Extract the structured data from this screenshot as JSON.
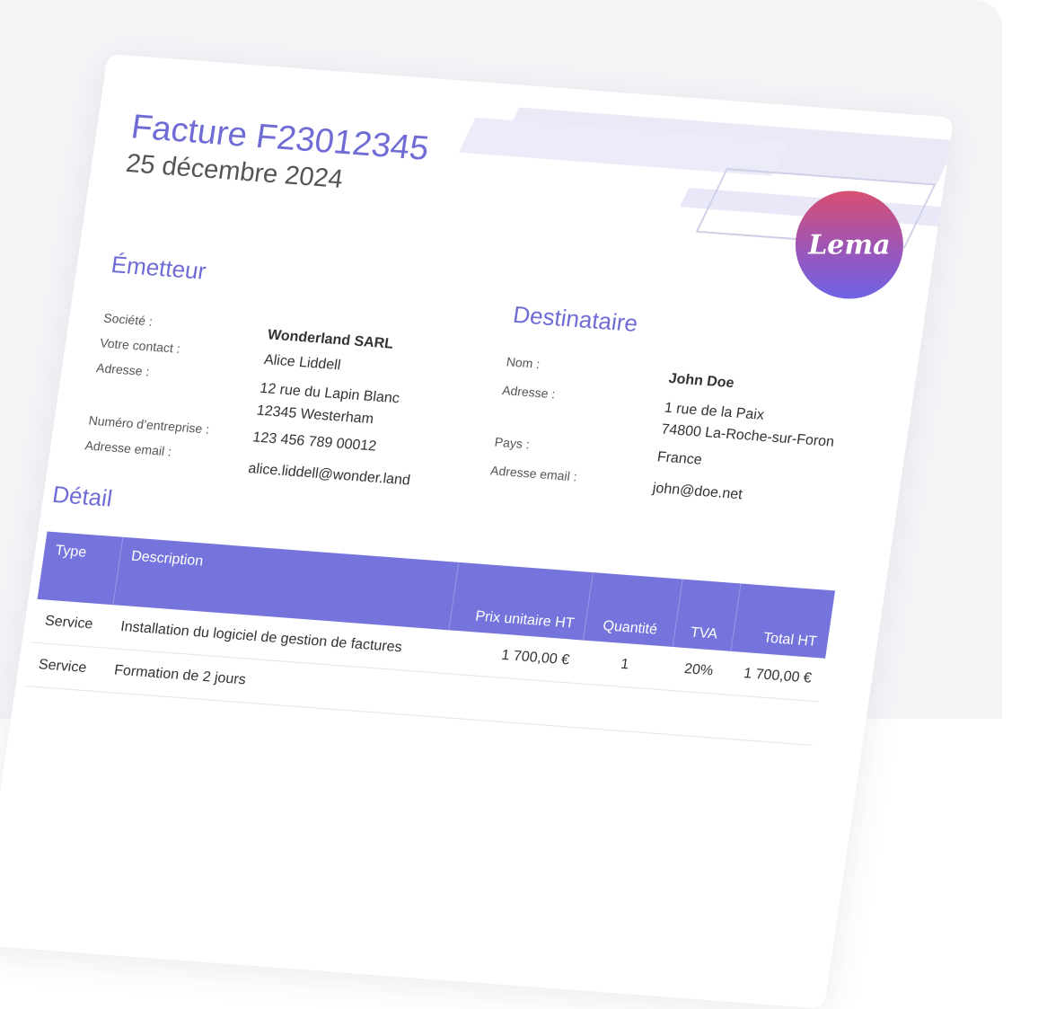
{
  "invoice": {
    "title": "Facture F23012345",
    "date": "25 décembre 2024",
    "logo_text": "Lema"
  },
  "emitter": {
    "heading": "Émetteur",
    "company_label": "Société :",
    "contact_label": "Votre contact :",
    "address_label": "Adresse :",
    "company_number_label": "Numéro d’entreprise :",
    "email_label": "Adresse email :",
    "company": "Wonderland SARL",
    "contact": "Alice Liddell",
    "address_line1": "12 rue du Lapin Blanc",
    "address_line2": "12345 Westerham",
    "company_number": "123 456 789 00012",
    "email": "alice.liddell@wonder.land"
  },
  "recipient": {
    "heading": "Destinataire",
    "name_label": "Nom :",
    "address_label": "Adresse :",
    "country_label": "Pays :",
    "email_label": "Adresse email :",
    "name": "John Doe",
    "address_line1": "1 rue de la Paix",
    "address_line2": "74800 La-Roche-sur-Foron",
    "country": "France",
    "email": "john@doe.net"
  },
  "detail": {
    "heading": "Détail",
    "columns": [
      "Type",
      "Description",
      "Prix unitaire HT",
      "Quantité",
      "TVA",
      "Total HT"
    ],
    "rows": [
      {
        "type": "Service",
        "description": "Installation du logiciel de gestion de factures",
        "unit_price": "1 700,00 €",
        "quantity": "1",
        "vat": "20%",
        "total": "1 700,00 €"
      },
      {
        "type": "Service",
        "description": "Formation de 2 jours",
        "unit_price": "",
        "quantity": "",
        "vat": "",
        "total": ""
      }
    ]
  },
  "colors": {
    "accent": "#7574dc",
    "logo_gradient_top": "#d74f72",
    "logo_gradient_bottom": "#6f63e6"
  }
}
